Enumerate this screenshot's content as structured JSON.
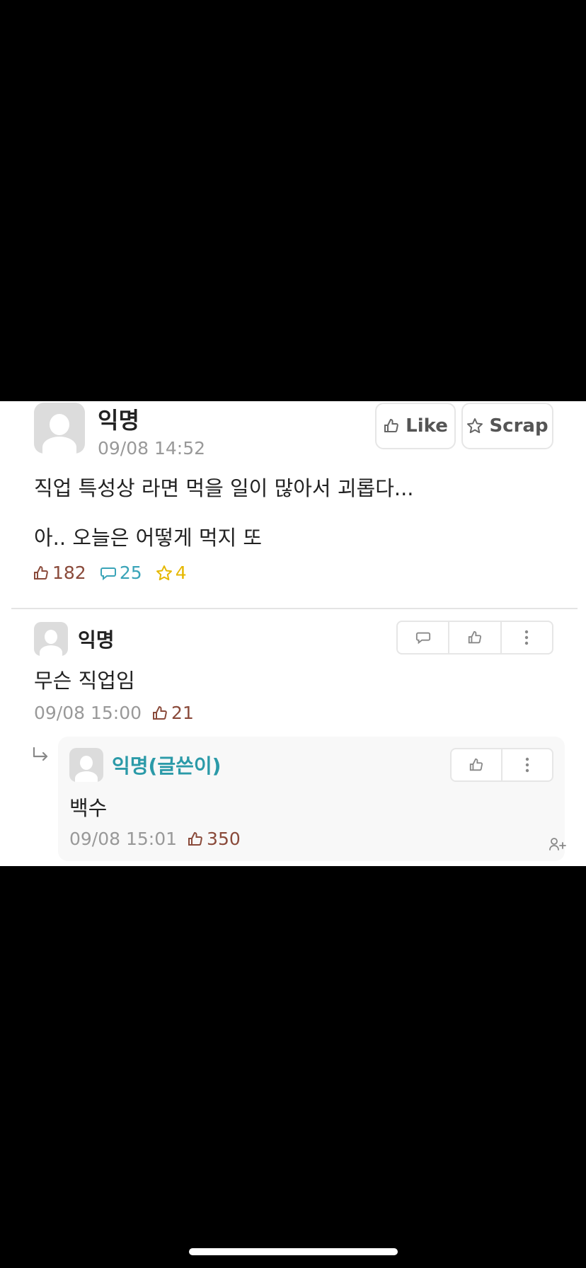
{
  "post": {
    "author": "익명",
    "timestamp": "09/08 14:52",
    "like_button_label": "Like",
    "scrap_button_label": "Scrap",
    "line1": "직업 특성상 라면 먹을 일이 많아서 괴롭다...",
    "line2": "아.. 오늘은 어떻게 먹지 또",
    "likes": "182",
    "comments": "25",
    "scraps": "4"
  },
  "comment": {
    "author": "익명",
    "text": "무슨 직업임",
    "timestamp": "09/08 15:00",
    "likes": "21"
  },
  "reply": {
    "author": "익명(글쓴이)",
    "text": "백수",
    "timestamp": "09/08 15:01",
    "likes": "350"
  },
  "colors": {
    "like": "#8a4a3a",
    "comment": "#3aa4b8",
    "scrap": "#e6b800",
    "op_author": "#2b9aa8"
  },
  "icons": {
    "like": "thumbs-up-icon",
    "comment": "speech-bubble-icon",
    "scrap": "star-icon",
    "more": "vertical-dots-icon",
    "reply_arrow": "reply-arrow-icon",
    "mention": "mention-icon"
  }
}
